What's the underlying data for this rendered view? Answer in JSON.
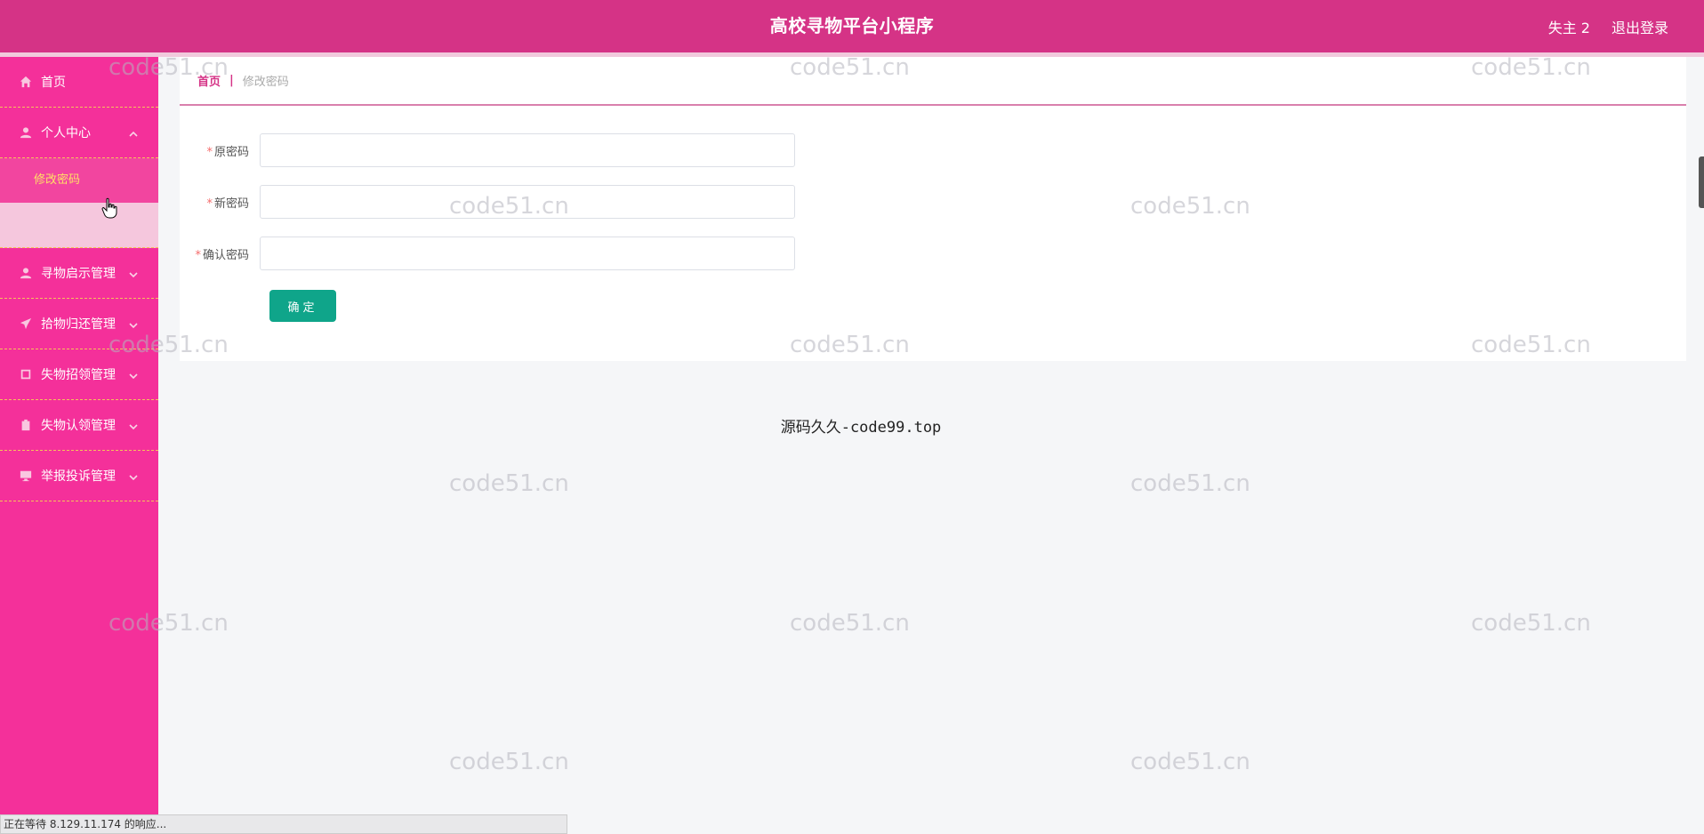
{
  "header": {
    "title": "高校寻物平台小程序",
    "user": "失主 2",
    "logout": "退出登录"
  },
  "sidebar": {
    "items": [
      {
        "label": "首页",
        "icon": "home-icon",
        "expandable": false
      },
      {
        "label": "个人中心",
        "icon": "user-icon",
        "expandable": true,
        "expanded": true,
        "children": [
          {
            "label": "修改密码",
            "active": true
          }
        ]
      },
      {
        "label": "寻物启示管理",
        "icon": "user-icon",
        "expandable": true
      },
      {
        "label": "拾物归还管理",
        "icon": "paper-plane-icon",
        "expandable": true
      },
      {
        "label": "失物招领管理",
        "icon": "square-icon",
        "expandable": true
      },
      {
        "label": "失物认领管理",
        "icon": "clipboard-icon",
        "expandable": true
      },
      {
        "label": "举报投诉管理",
        "icon": "monitor-icon",
        "expandable": true
      }
    ]
  },
  "breadcrumb": {
    "home": "首页",
    "separator": "|",
    "current": "修改密码"
  },
  "form": {
    "fields": [
      {
        "label": "原密码",
        "required": true,
        "value": ""
      },
      {
        "label": "新密码",
        "required": true,
        "value": ""
      },
      {
        "label": "确认密码",
        "required": true,
        "value": ""
      }
    ],
    "submit": "确定"
  },
  "footer": "源码久久-code99.top",
  "watermark": "code51.cn",
  "statusbar": "正在等待 8.129.11.174 的响应...",
  "colors": {
    "header": "#d53386",
    "sidebar": "#f4309a",
    "submit": "#0fa58a",
    "active_submenu_text": "#ffe066"
  }
}
